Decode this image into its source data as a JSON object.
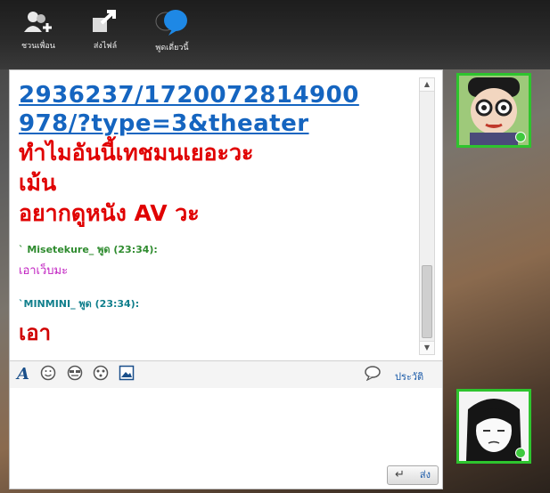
{
  "toolbar": {
    "invite_label": "ชวนเพื่อน",
    "send_file_label": "ส่งไฟล์",
    "private_chat_label": "พูดเดี่ยวนี้"
  },
  "messages": {
    "link_line1": "2936237/1720072814900",
    "link_line2": "978/?type=3&theater",
    "red_line1": "ทำไมอันนี้เทชมนเยอะวะ",
    "red_line2": "เม้น",
    "red_line3": "อยากดูหนัง AV วะ",
    "msg1_sender": "` Misetekure_ พูด  (23:34):",
    "msg1_text": "เอาเว็บมะ",
    "msg2_sender": "`MINMINI_ พูด  (23:34):",
    "msg2_text": "เอา"
  },
  "input_toolbar": {
    "history_label": "ประวัติ"
  },
  "send_button": {
    "label": "ส่ง"
  },
  "colors": {
    "accent_green": "#2ec42e",
    "link_blue": "#1565c0",
    "alert_red": "#e00000"
  }
}
